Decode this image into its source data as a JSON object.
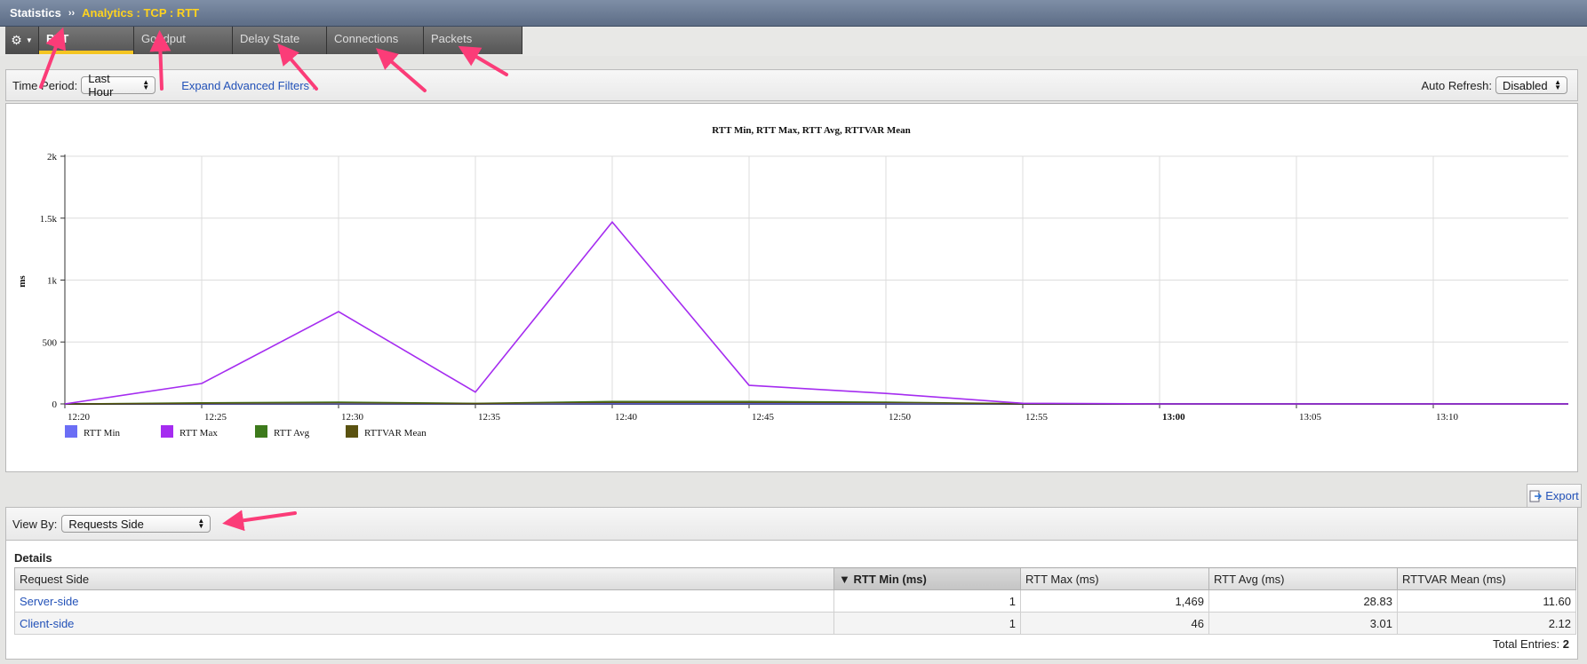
{
  "breadcrumb": {
    "root": "Statistics",
    "separator": "››",
    "current": "Analytics : TCP : RTT"
  },
  "gear_menu": {
    "icon": "gear-icon"
  },
  "tabs": [
    {
      "label": "RTT",
      "active": true
    },
    {
      "label": "Goodput",
      "active": false
    },
    {
      "label": "Delay State",
      "active": false
    },
    {
      "label": "Connections",
      "active": false
    },
    {
      "label": "Packets",
      "active": false
    }
  ],
  "filters": {
    "time_period_label": "Time Period:",
    "time_period_value": "Last Hour",
    "expand_filters": "Expand Advanced Filters",
    "expand_glyph": "»",
    "auto_refresh_label": "Auto Refresh:",
    "auto_refresh_value": "Disabled"
  },
  "chart_data": {
    "type": "line",
    "title": "RTT Min, RTT Max, RTT Avg, RTTVAR Mean",
    "ylabel": "ms",
    "xlabel": "",
    "x": [
      "12:20",
      "12:25",
      "12:30",
      "12:35",
      "12:40",
      "12:45",
      "12:50",
      "12:55",
      "13:00",
      "13:05",
      "13:10"
    ],
    "x_ticks": [
      "12:20",
      "12:25",
      "12:30",
      "12:35",
      "12:40",
      "12:45",
      "12:50",
      "12:55",
      "13:00",
      "13:05",
      "13:10"
    ],
    "y_ticks": [
      "0",
      "500",
      "1k",
      "1.5k",
      "2k"
    ],
    "ylim": [
      0,
      2000
    ],
    "grid": true,
    "legend_position": "bottom-left",
    "series": [
      {
        "name": "RTT Min",
        "color": "#6b6ef5",
        "values": [
          1,
          1,
          1,
          1,
          1,
          1,
          1,
          1,
          1,
          1,
          1
        ]
      },
      {
        "name": "RTT Max",
        "color": "#a52cf0",
        "values": [
          0,
          165,
          745,
          95,
          1469,
          150,
          85,
          5,
          0,
          0,
          0
        ]
      },
      {
        "name": "RTT Avg",
        "color": "#3d7a1c",
        "values": [
          0,
          10,
          15,
          5,
          20,
          20,
          15,
          3,
          0,
          0,
          0
        ]
      },
      {
        "name": "RTTVAR Mean",
        "color": "#5a5210",
        "values": [
          0,
          5,
          8,
          3,
          12,
          12,
          10,
          2,
          0,
          0,
          0
        ]
      }
    ]
  },
  "export": {
    "label": "Export",
    "icon": "export-icon"
  },
  "view_by": {
    "label": "View By:",
    "value": "Requests Side"
  },
  "details": {
    "title": "Details",
    "columns": [
      "Request Side",
      "RTT Min (ms)",
      "RTT Max (ms)",
      "RTT Avg (ms)",
      "RTTVAR Mean (ms)"
    ],
    "sort_glyph": "▼",
    "rows": [
      [
        "Server-side",
        "1",
        "1,469",
        "28.83",
        "11.60"
      ],
      [
        "Client-side",
        "1",
        "46",
        "3.01",
        "2.12"
      ]
    ],
    "total_label": "Total Entries:",
    "total_value": "2"
  },
  "colors": {
    "annotation_arrow": "#fb3c78",
    "accent_tab": "#f4c522",
    "link": "#2352b8"
  }
}
